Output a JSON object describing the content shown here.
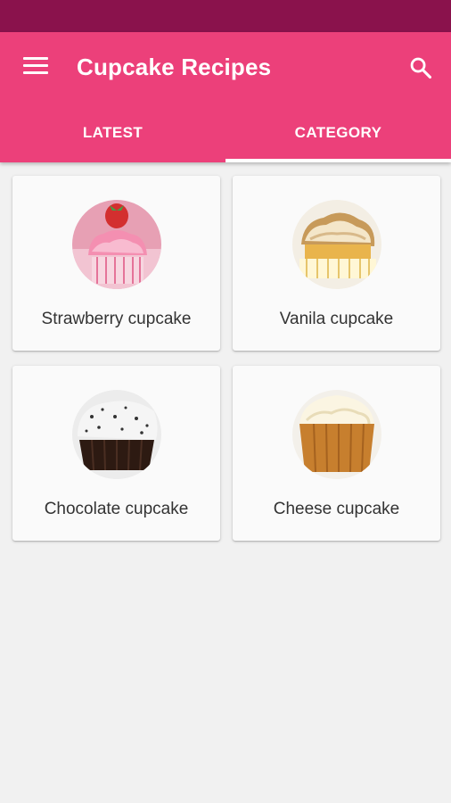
{
  "app": {
    "title": "Cupcake Recipes"
  },
  "icons": {
    "menu": "menu-icon",
    "search": "search-icon"
  },
  "colors": {
    "status_bar": "#8a124c",
    "app_bar": "#ec407a",
    "background": "#f1f1f1"
  },
  "tabs": [
    {
      "label": "LATEST",
      "active": false
    },
    {
      "label": "CATEGORY",
      "active": true
    }
  ],
  "categories": [
    {
      "label": "Strawberry cupcake"
    },
    {
      "label": "Vanila cupcake"
    },
    {
      "label": "Chocolate cupcake"
    },
    {
      "label": "Cheese cupcake"
    }
  ]
}
